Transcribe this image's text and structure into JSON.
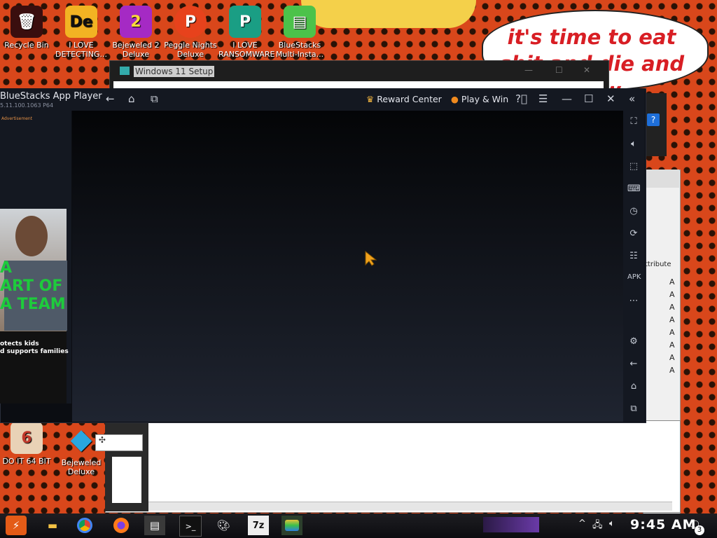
{
  "wallpaper": {
    "bubble_text": "it's time to eat shit and die and chew"
  },
  "desktop_icons": [
    {
      "label": "Recycle Bin",
      "glyph": "🗑",
      "color": "#8a2b2b"
    },
    {
      "label": "I LOVE DETECTING...",
      "glyph": "De",
      "color": "#1c1c1c"
    },
    {
      "label": "Bejeweled 2 Deluxe",
      "glyph": "2",
      "color": "#2b3fd6"
    },
    {
      "label": "Peggle Nights Deluxe",
      "glyph": "P",
      "color": "#e7421c"
    },
    {
      "label": "I LOVE RANSOMWARE",
      "glyph": "P",
      "color": "#11a085"
    },
    {
      "label": "BlueStacks Multi-Insta...",
      "glyph": "▤",
      "color": "#4cc24a"
    },
    {
      "label": "DO IT 64 BIT",
      "glyph": "6",
      "color": "#b86b4b"
    },
    {
      "label": "Bejeweled Deluxe",
      "glyph": "◆",
      "color": "#2aa7e0"
    }
  ],
  "setup_window": {
    "title": "Windows 11 Setup",
    "controls": [
      "—",
      "☐",
      "✕"
    ]
  },
  "bluestacks": {
    "app_name": "BlueStacks App Player",
    "version": "5.11.100.1063 P64",
    "reward_label": "Reward Center",
    "play_label": "Play & Win",
    "ad_label": "Advertisement",
    "ad_headline": [
      "A",
      "ART OF",
      "A TEAM"
    ],
    "ad_caption": [
      "otects kids",
      "d supports families"
    ]
  },
  "right_windows": {
    "attr_label": "ttribute",
    "rows": [
      "A",
      "A",
      "A",
      "A",
      "A",
      "A",
      "A",
      "A"
    ]
  },
  "taskbar": {
    "clock": "9:45 AM",
    "notification_count": "3",
    "items": [
      "start",
      "file-explorer",
      "chrome",
      "firefox",
      "setup",
      "terminal",
      "paint",
      "7zip",
      "bluestacks"
    ],
    "seven_zip_label": "7z"
  }
}
